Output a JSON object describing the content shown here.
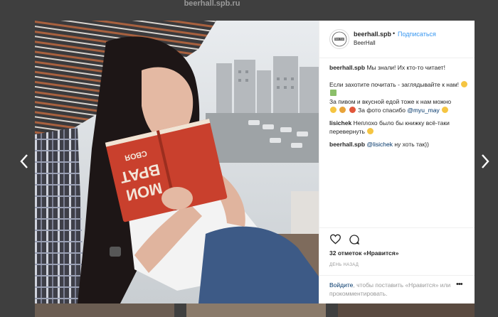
{
  "browser": {
    "url_text": "beerhall.spb.ru"
  },
  "modal": {
    "header": {
      "username": "beerhall.spb",
      "separator": "•",
      "follow_label": "Подписаться",
      "location": "BeerHall"
    },
    "comments": [
      {
        "author": "beerhall.spb",
        "line1": "Мы знали! Их кто-то читает!",
        "line2": "Если захотите почитать - заглядывайте к нам!",
        "line3": "За пивом и вкусной едой тоже к нам можно",
        "line4_text": "За фото спасибо",
        "line4_mention": "@myu_may"
      },
      {
        "author": "lisichek",
        "text": "Неплохо было бы книжку всё-таки перевернуть"
      },
      {
        "author": "beerhall.spb",
        "mention": "@lisichek",
        "text": "ну хоть так))"
      }
    ],
    "likes": "32 отметок «Нравится»",
    "timestamp": "ДЕНЬ НАЗАД",
    "add_comment": {
      "login_link": "Войдите",
      "text": ", чтобы поставить «Нравится» или прокомментировать."
    },
    "more_label": "•••"
  },
  "photo": {
    "book_title_lines": [
      "МОИ",
      "ВРАТ",
      "СВОЯ"
    ]
  },
  "icons": [
    "chevron-left-icon",
    "chevron-right-icon",
    "heart-icon",
    "comment-icon",
    "more-icon"
  ],
  "colors": {
    "link": "#3897f0",
    "mention": "#003569",
    "text": "#262626",
    "muted": "#999999",
    "backdrop": "#3f3f3f"
  }
}
